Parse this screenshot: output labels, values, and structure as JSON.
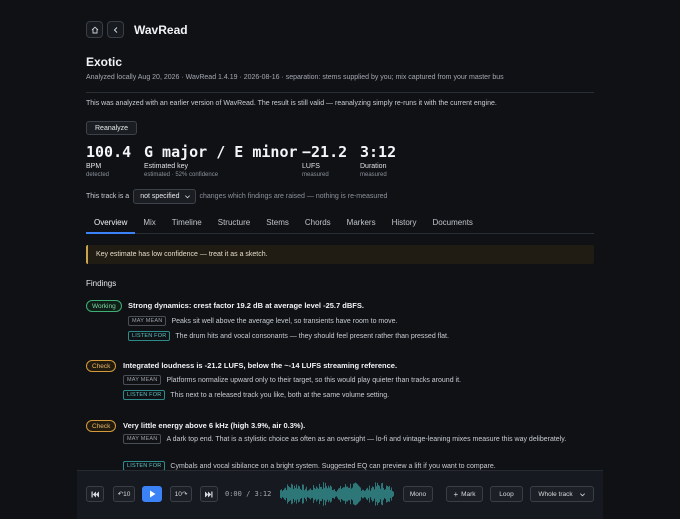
{
  "app": {
    "name": "WavRead"
  },
  "nav": {
    "home_icon": "home-icon",
    "back_icon": "back-arrow-icon"
  },
  "track": {
    "title": "Exotic",
    "meta": "Analyzed locally Aug 20, 2026 · WavRead 1.4.19 · 2026-08-16 · separation: stems supplied by you; mix captured from your master bus"
  },
  "notice": "This was analyzed with an earlier version of WavRead. The result is still valid — reanalyzing simply re-runs it with the current engine.",
  "reanalyze_label": "Reanalyze",
  "stats": [
    {
      "value": "100.4",
      "label": "BPM",
      "sub": "detected"
    },
    {
      "value": "G major / E minor",
      "label": "Estimated key",
      "sub": "estimated · 52% confidence"
    },
    {
      "value": "−21.2",
      "label": "LUFS",
      "sub": "measured"
    },
    {
      "value": "3:12",
      "label": "Duration",
      "sub": "measured"
    }
  ],
  "track_is": {
    "prefix": "This track is a",
    "selected": "not specified",
    "hint": "changes which findings are raised — nothing is re-measured"
  },
  "tabs": [
    "Overview",
    "Mix",
    "Timeline",
    "Structure",
    "Stems",
    "Chords",
    "Markers",
    "History",
    "Documents"
  ],
  "active_tab": "Overview",
  "banner": "Key estimate has low confidence — treat it as a sketch.",
  "findings_title": "Findings",
  "findings": [
    {
      "badge": "Working",
      "headline": "Strong dynamics: crest factor 19.2 dB at average level -25.7 dBFS.",
      "may_mean_tag": "MAY MEAN",
      "may_mean": "Peaks sit well above the average level, so transients have room to move.",
      "listen_for_tag": "LISTEN FOR",
      "listen_for": "The drum hits and vocal consonants — they should feel present rather than pressed flat."
    },
    {
      "badge": "Check",
      "headline": "Integrated loudness is -21.2 LUFS, below the ~-14 LUFS streaming reference.",
      "may_mean_tag": "MAY MEAN",
      "may_mean": "Platforms normalize upward only to their target, so this would play quieter than tracks around it.",
      "listen_for_tag": "LISTEN FOR",
      "listen_for": "This next to a released track you like, both at the same volume setting."
    },
    {
      "badge": "Check",
      "headline": "Very little energy above 6 kHz (high 3.9%, air 0.3%).",
      "may_mean_tag": "MAY MEAN",
      "may_mean": "A dark top end. That is a stylistic choice as often as an oversight — lo-fi and vintage-leaning mixes measure this way deliberately.",
      "listen_for_tag": "LISTEN FOR",
      "listen_for": "Cymbals and vocal sibilance on a bright system. Suggested EQ can preview a lift if you want to compare."
    }
  ],
  "player": {
    "skip_start_icon": "skip-start-icon",
    "back10": "↶10",
    "play_icon": "play-icon",
    "fwd10": "10↷",
    "skip_end_icon": "skip-end-icon",
    "time": "0:00 / 3:12",
    "mono": "Mono",
    "mark": "Mark",
    "loop": "Loop",
    "range": "Whole track",
    "progress": 0
  },
  "colors": {
    "accent": "#3b82f6",
    "working": "#3fae74",
    "check": "#d49a3a",
    "listen": "#2f8a8a",
    "waveform": "#3aa3a3"
  }
}
